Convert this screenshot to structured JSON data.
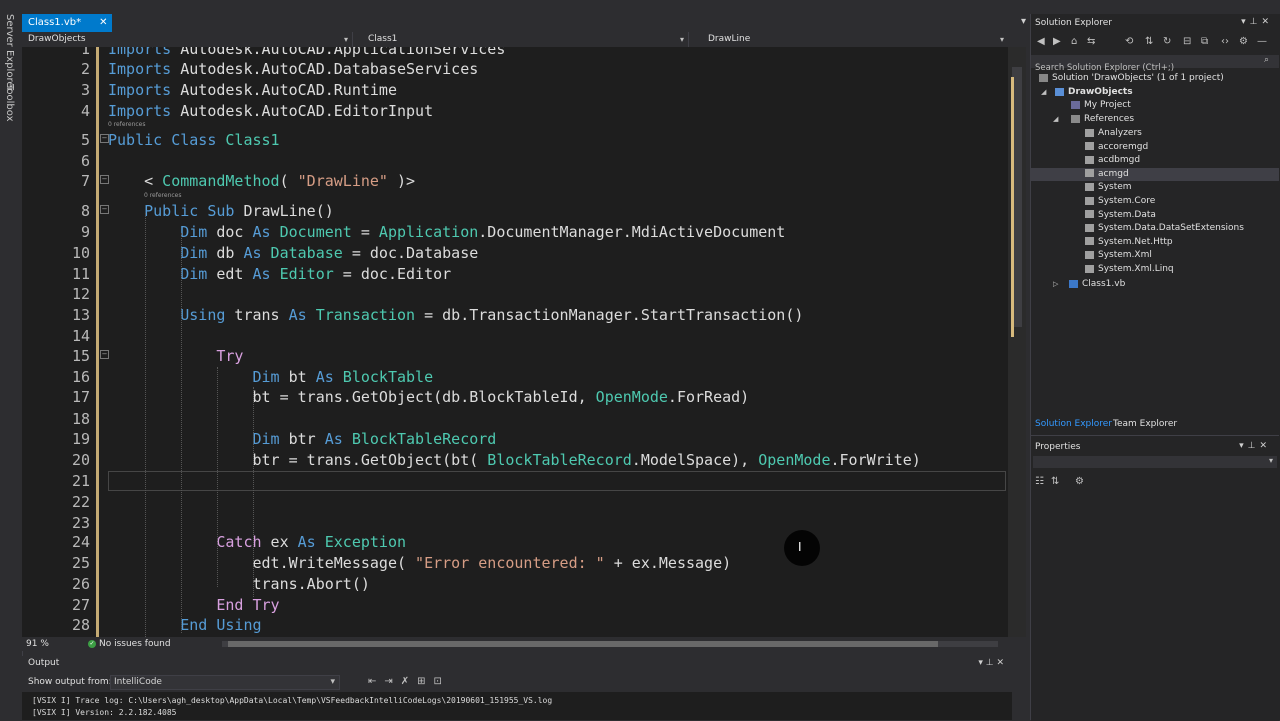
{
  "sidebar": {
    "server_explorer": "Server Explorer",
    "toolbox": "Toolbox"
  },
  "tab": {
    "label": "Class1.vb*",
    "close": "✕",
    "dropdown": "▾"
  },
  "navbar": {
    "project": "DrawObjects",
    "class": "Class1",
    "member": "DrawLine"
  },
  "editor": {
    "lines": [
      {
        "n": "1",
        "segs": [
          [
            "kw",
            "Imports"
          ],
          [
            "",
            "Autodesk.AutoCAD.ApplicationServices"
          ]
        ]
      },
      {
        "n": "2",
        "segs": [
          [
            "kw",
            "Imports"
          ],
          [
            "",
            "Autodesk.AutoCAD.DatabaseServices"
          ]
        ]
      },
      {
        "n": "3",
        "segs": [
          [
            "kw",
            "Imports"
          ],
          [
            "",
            "Autodesk.AutoCAD.Runtime"
          ]
        ]
      },
      {
        "n": "4",
        "segs": [
          [
            "kw",
            "Imports"
          ],
          [
            "",
            "Autodesk.AutoCAD.EditorInput"
          ]
        ]
      },
      {
        "n": "5",
        "segs": [
          [
            "kw",
            "Public Class"
          ],
          [
            "ty",
            "Class1"
          ]
        ]
      },
      {
        "n": "6",
        "segs": []
      },
      {
        "n": "7",
        "segs": [
          [
            "",
            "    <"
          ],
          [
            "ty",
            "CommandMethod"
          ],
          [
            "",
            "("
          ],
          [
            "st",
            "\"DrawLine\""
          ],
          [
            "",
            ")>"
          ]
        ]
      },
      {
        "n": "8",
        "segs": [
          [
            "kw",
            "    Public Sub"
          ],
          [
            "",
            "DrawLine()"
          ]
        ]
      },
      {
        "n": "9",
        "segs": [
          [
            "kw",
            "        Dim"
          ],
          [
            "",
            "doc"
          ],
          [
            "kw",
            "As"
          ],
          [
            "ty",
            "Document"
          ],
          [
            "",
            "="
          ],
          [
            "ty",
            "Application"
          ],
          [
            "",
            ".DocumentManager.MdiActiveDocument"
          ]
        ]
      },
      {
        "n": "10",
        "segs": [
          [
            "kw",
            "        Dim"
          ],
          [
            "",
            "db"
          ],
          [
            "kw",
            "As"
          ],
          [
            "ty",
            "Database"
          ],
          [
            "",
            "= doc.Database"
          ]
        ]
      },
      {
        "n": "11",
        "segs": [
          [
            "kw",
            "        Dim"
          ],
          [
            "",
            "edt"
          ],
          [
            "kw",
            "As"
          ],
          [
            "ty",
            "Editor"
          ],
          [
            "",
            "= doc.Editor"
          ]
        ]
      },
      {
        "n": "12",
        "segs": []
      },
      {
        "n": "13",
        "segs": [
          [
            "kw",
            "        Using"
          ],
          [
            "",
            "trans"
          ],
          [
            "kw",
            "As"
          ],
          [
            "ty",
            "Transaction"
          ],
          [
            "",
            "= db.TransactionManager.StartTransaction()"
          ]
        ]
      },
      {
        "n": "14",
        "segs": []
      },
      {
        "n": "15",
        "segs": [
          [
            "ctl",
            "            Try"
          ]
        ]
      },
      {
        "n": "16",
        "segs": [
          [
            "kw",
            "                Dim"
          ],
          [
            "",
            "bt"
          ],
          [
            "kw",
            "As"
          ],
          [
            "ty",
            "BlockTable"
          ]
        ]
      },
      {
        "n": "17",
        "segs": [
          [
            "",
            "                bt = trans.GetObject(db.BlockTableId,"
          ],
          [
            "ty",
            "OpenMode"
          ],
          [
            "",
            ".ForRead)"
          ]
        ]
      },
      {
        "n": "18",
        "segs": []
      },
      {
        "n": "19",
        "segs": [
          [
            "kw",
            "                Dim"
          ],
          [
            "",
            "btr"
          ],
          [
            "kw",
            "As"
          ],
          [
            "ty",
            "BlockTableRecord"
          ]
        ]
      },
      {
        "n": "20",
        "segs": [
          [
            "",
            "                btr = trans.GetObject(bt("
          ],
          [
            "ty",
            "BlockTableRecord"
          ],
          [
            "",
            ".ModelSpace),"
          ],
          [
            "ty",
            "OpenMode"
          ],
          [
            "",
            ".ForWrite)"
          ]
        ]
      },
      {
        "n": "21",
        "segs": []
      },
      {
        "n": "22",
        "segs": []
      },
      {
        "n": "23",
        "segs": []
      },
      {
        "n": "24",
        "segs": [
          [
            "ctl",
            "            Catch"
          ],
          [
            "",
            "ex"
          ],
          [
            "kw",
            "As"
          ],
          [
            "ty",
            "Exception"
          ]
        ]
      },
      {
        "n": "25",
        "segs": [
          [
            "",
            "                edt.WriteMessage("
          ],
          [
            "st",
            "\"Error encountered: \""
          ],
          [
            "",
            "+ ex.Message)"
          ]
        ]
      },
      {
        "n": "26",
        "segs": [
          [
            "",
            "                trans.Abort()"
          ]
        ]
      },
      {
        "n": "27",
        "segs": [
          [
            "ctl",
            "            End Try"
          ]
        ]
      },
      {
        "n": "28",
        "segs": [
          [
            "kw",
            "        End Using"
          ]
        ]
      }
    ],
    "references": [
      "0 references",
      "0 references"
    ]
  },
  "status": {
    "zoom": "91 %",
    "issues": "No issues found"
  },
  "output": {
    "title": "Output",
    "show_from_label": "Show output from:",
    "show_from_value": "IntelliCode",
    "lines": [
      "[VSIX I] Trace log: C:\\Users\\agh_desktop\\AppData\\Local\\Temp\\VSFeedbackIntelliCodeLogs\\20190601_151955_VS.log",
      "[VSIX I] Version: 2.2.182.4085"
    ]
  },
  "solution_explorer": {
    "title": "Solution Explorer",
    "search_placeholder": "Search Solution Explorer (Ctrl+;)",
    "solution": "Solution 'DrawObjects' (1 of 1 project)",
    "project": "DrawObjects",
    "my_project": "My Project",
    "references": "References",
    "refs": [
      "Analyzers",
      "accoremgd",
      "acdbmgd",
      "acmgd",
      "System",
      "System.Core",
      "System.Data",
      "System.Data.DataSetExtensions",
      "System.Net.Http",
      "System.Xml",
      "System.Xml.Linq"
    ],
    "selected_ref": "acmgd",
    "class_file": "Class1.vb",
    "tabs": [
      "Solution Explorer",
      "Team Explorer"
    ]
  },
  "properties": {
    "title": "Properties"
  },
  "colors": {
    "accent": "#007acc",
    "keyword": "#569cd6",
    "type": "#4ec9b0",
    "string": "#d69d85",
    "control": "#d8a0df"
  }
}
